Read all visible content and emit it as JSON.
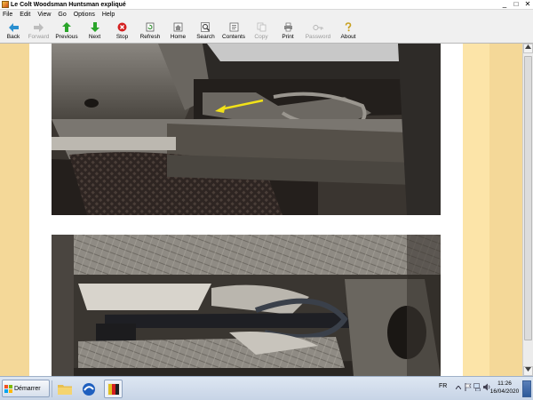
{
  "window": {
    "title": "Le Colt Woodsman Huntsman expliqué",
    "controls": {
      "minimize": "_",
      "maximize": "□",
      "close": "✕"
    }
  },
  "menu": [
    "File",
    "Edit",
    "View",
    "Go",
    "Options",
    "Help"
  ],
  "toolbar": {
    "back": "Back",
    "forward": "Forward",
    "previous": "Previous",
    "next": "Next",
    "stop": "Stop",
    "refresh": "Refresh",
    "home": "Home",
    "search": "Search",
    "contents": "Contents",
    "copy": "Copy",
    "print": "Print",
    "password": "Password",
    "about": "About"
  },
  "icons": {
    "back": "left-arrow-icon",
    "forward": "right-arrow-icon",
    "previous": "up-arrow-icon",
    "next": "down-arrow-icon",
    "stop": "stop-icon",
    "refresh": "refresh-icon",
    "home": "home-icon",
    "search": "search-icon",
    "contents": "contents-icon",
    "copy": "copy-icon",
    "print": "print-icon",
    "password": "key-icon",
    "about": "question-icon"
  },
  "colors": {
    "page_background": "#f4d898",
    "side_stripe": "#fce4a8",
    "arrow_green": "#2aa52a",
    "stop_red": "#d42020",
    "annotation_yellow": "#f2e218"
  },
  "taskbar": {
    "start_label": "Démarrer",
    "language": "FR",
    "time": "11:26",
    "date": "16/04/2020"
  }
}
